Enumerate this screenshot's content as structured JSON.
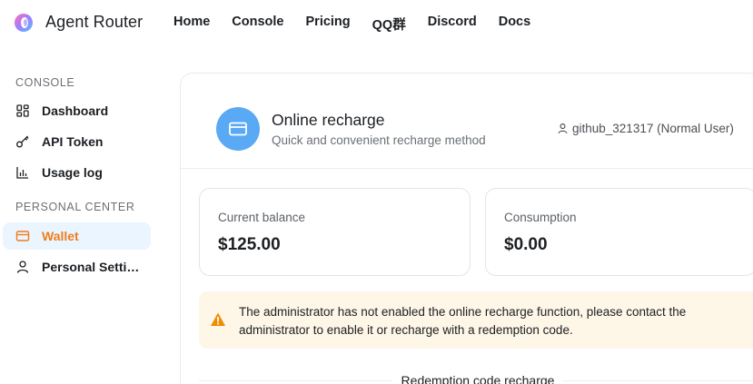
{
  "app": {
    "brand": "Agent Router"
  },
  "nav": {
    "items": [
      "Home",
      "Console",
      "Pricing",
      "QQ群",
      "Discord",
      "Docs"
    ]
  },
  "sidebar": {
    "section_console": "CONSOLE",
    "section_personal": "PERSONAL CENTER",
    "items": [
      {
        "label": "Dashboard",
        "icon": "dashboard-icon"
      },
      {
        "label": "API Token",
        "icon": "key-icon"
      },
      {
        "label": "Usage log",
        "icon": "bar-chart-icon"
      },
      {
        "label": "Wallet",
        "icon": "wallet-icon",
        "active": true
      },
      {
        "label": "Personal Settin...",
        "icon": "user-icon"
      }
    ]
  },
  "main": {
    "title": "Online recharge",
    "subtitle": "Quick and convenient recharge method",
    "user": "github_321317 (Normal User)",
    "balance_label": "Current balance",
    "balance_value": "$125.00",
    "consumption_label": "Consumption",
    "consumption_value": "$0.00",
    "warning": "The administrator has not enabled the online recharge function, please contact the administrator to enable it or recharge with a redemption code.",
    "redeem_heading": "Redemption code recharge"
  },
  "colors": {
    "accent": "#f07c1c",
    "avatar": "#5aa9f5",
    "active_bg": "#eaf5ff",
    "warn_bg": "#fef6e7",
    "warn_icon": "#f08c00"
  }
}
